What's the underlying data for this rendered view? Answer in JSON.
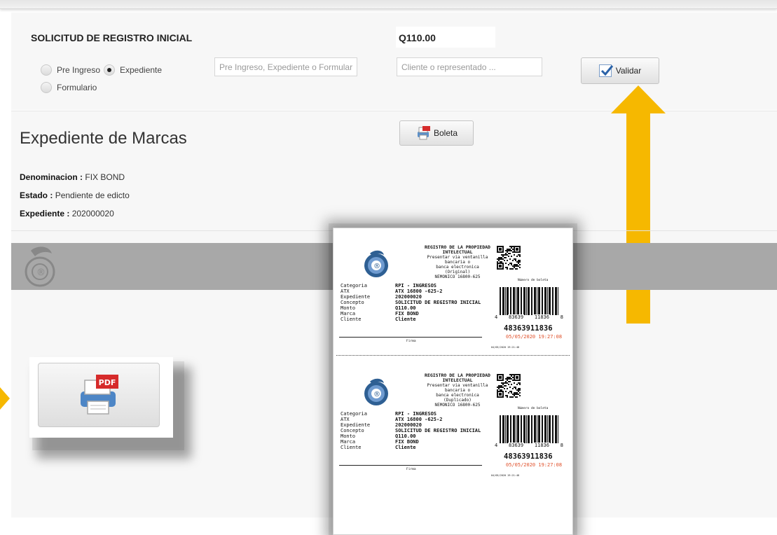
{
  "form": {
    "title": "SOLICITUD DE REGISTRO INICIAL",
    "amount": "Q110.00",
    "radios": [
      {
        "label": "Pre Ingreso",
        "checked": false
      },
      {
        "label": "Expediente",
        "checked": true
      },
      {
        "label": "Formulario",
        "checked": false
      }
    ],
    "search_placeholder": "Pre Ingreso, Expediente o Formulario",
    "client_placeholder": "Cliente o representado ...",
    "validate_label": "Validar"
  },
  "expediente": {
    "heading": "Expediente de Marcas",
    "boleta_label": "Boleta",
    "fields": [
      {
        "label": "Denominacion :",
        "value": "FIX BOND"
      },
      {
        "label": "Estado :",
        "value": "Pendiente de edicto"
      },
      {
        "label": "Expediente :",
        "value": "202000020"
      }
    ]
  },
  "zoom": {
    "pdf_badge": "PDF"
  },
  "receipt": {
    "slips": [
      {
        "header": [
          "REGISTRO DE LA PROPIEDAD",
          "INTELECTUAL",
          "Presentar via ventanilla bancaria o",
          "banca electronica",
          "(Original)",
          "NEMONICO 16800-625"
        ],
        "rows": [
          {
            "label": "Categoria",
            "value": "RPI - INGRESOS"
          },
          {
            "label": "ATX",
            "value": "ATX 16800 -625-2"
          },
          {
            "label": "Expediente",
            "value": "202000020"
          },
          {
            "label": "Concepto",
            "value": "SOLICITUD DE REGISTRO INICIAL"
          },
          {
            "label": "Monto",
            "value": "Q110.00"
          },
          {
            "label": "Marca",
            "value": "FIX BOND"
          },
          {
            "label": "Cliente",
            "value": "Cliente"
          }
        ],
        "qr_label": "Número de boleta",
        "barcode_digits": [
          "4",
          "83639",
          "11836",
          "8"
        ],
        "number": "48363911836",
        "date": "05/05/2020 19:27:08",
        "firma": "Firma",
        "small_date": "04/05/2020 19:21:48"
      },
      {
        "header": [
          "REGISTRO DE LA PROPIEDAD",
          "INTELECTUAL",
          "Presentar via ventanilla bancaria o",
          "banca electronica",
          "(Duplicado)",
          "NEMONICO 16800-625"
        ],
        "rows": [
          {
            "label": "Categoria",
            "value": "RPI - INGRESOS"
          },
          {
            "label": "ATX",
            "value": "ATX 16800 -625-2"
          },
          {
            "label": "Expediente",
            "value": "202000020"
          },
          {
            "label": "Concepto",
            "value": "SOLICITUD DE REGISTRO INICIAL"
          },
          {
            "label": "Monto",
            "value": "Q110.00"
          },
          {
            "label": "Marca",
            "value": "FIX BOND"
          },
          {
            "label": "Cliente",
            "value": "Cliente"
          }
        ],
        "qr_label": "Número de boleta",
        "barcode_digits": [
          "4",
          "83639",
          "11836",
          "8"
        ],
        "number": "48363911836",
        "date": "05/05/2020 19:27:08",
        "firma": "Firma",
        "small_date": "04/05/2020 19:21:48"
      }
    ]
  },
  "colors": {
    "accent_arrow": "#f6b800",
    "date_red": "#e0502a",
    "band_gray": "#a8a8a8"
  },
  "icons": [
    "check-icon",
    "printer-pdf-icon",
    "seal-logo-icon",
    "arrow-up-icon",
    "qr-code-icon",
    "barcode-icon"
  ]
}
